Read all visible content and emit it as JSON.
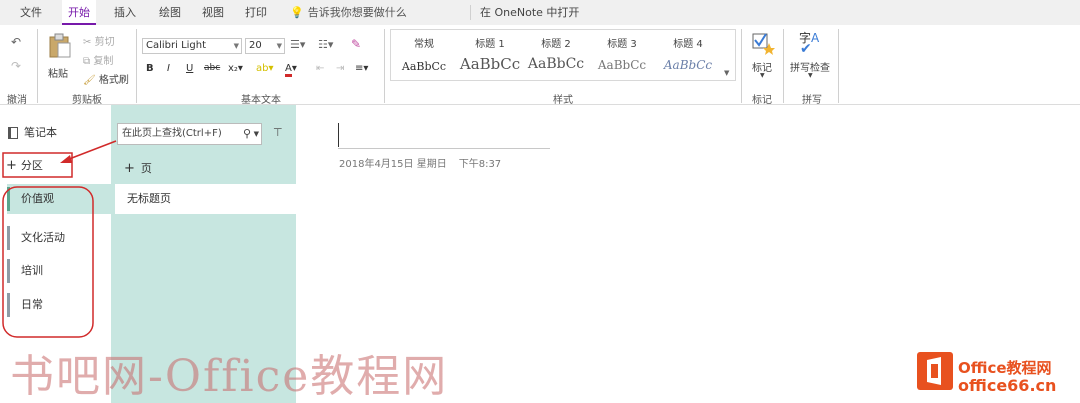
{
  "tabs": [
    {
      "label": "文件",
      "active": false
    },
    {
      "label": "开始",
      "active": true
    },
    {
      "label": "插入",
      "active": false
    },
    {
      "label": "绘图",
      "active": false
    },
    {
      "label": "视图",
      "active": false
    },
    {
      "label": "打印",
      "active": false
    }
  ],
  "tell_me": "告诉我你想要做什么",
  "open_in_onenote": "在 OneNote 中打开",
  "ribbon": {
    "undo_group": "撤消",
    "clipboard": {
      "paste": "粘贴",
      "cut": "剪切",
      "copy": "复制",
      "format_painter": "格式刷",
      "group": "剪贴板"
    },
    "font": {
      "name": "Calibri Light",
      "size": "20",
      "group": "基本文本"
    },
    "styles": {
      "items": [
        {
          "name": "常规",
          "preview": "AaBbCc"
        },
        {
          "name": "标题 1",
          "preview": "AaBbCc"
        },
        {
          "name": "标题 2",
          "preview": "AaBbCc"
        },
        {
          "name": "标题 3",
          "preview": "AaBbCc"
        },
        {
          "name": "标题 4",
          "preview": "AaBbCc"
        }
      ],
      "group": "样式"
    },
    "tags": {
      "label": "标记",
      "group": "标记"
    },
    "spelling": {
      "label": "拼写检查",
      "group": "拼写"
    }
  },
  "nav": {
    "notebook": "笔记本",
    "add_section": "分区",
    "sections": [
      {
        "label": "价值观",
        "active": true
      },
      {
        "label": "文化活动",
        "active": false
      },
      {
        "label": "培训",
        "active": false
      },
      {
        "label": "日常",
        "active": false
      }
    ]
  },
  "search": {
    "placeholder": "在此页上查找(Ctrl+F)"
  },
  "add_page": "页",
  "pages": [
    {
      "label": "无标题页"
    }
  ],
  "page": {
    "date": "2018年4月15日 星期日",
    "time": "下午8:37"
  },
  "watermark": {
    "text": "书吧网-Office教程网",
    "logo_line1": "Office教程网",
    "logo_line2": "office66.cn"
  },
  "colors": {
    "accent": "#7719aa",
    "pane": "#c7e6e0",
    "annotation": "#d12a2a"
  }
}
